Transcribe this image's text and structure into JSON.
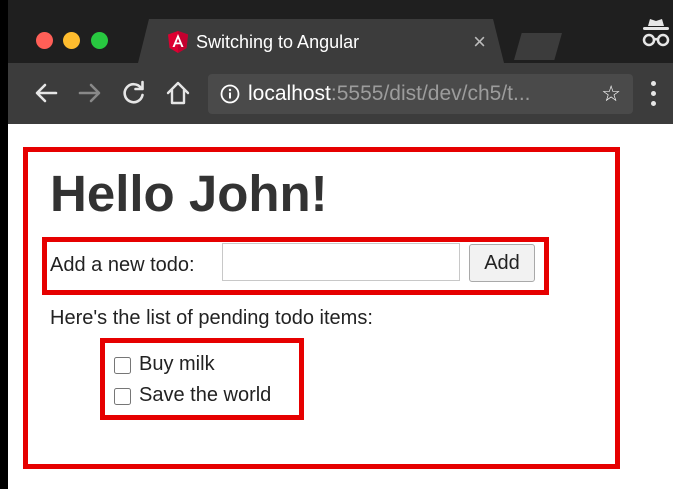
{
  "browser": {
    "tab": {
      "title": "Switching to Angular",
      "close_glyph": "×",
      "icon": "angular-logo"
    },
    "address_bar": {
      "host": "localhost",
      "path": ":5555/dist/dev/ch5/t...",
      "info_icon": "info-icon",
      "star_glyph": "☆"
    },
    "nav": {
      "back": "←",
      "forward": "→",
      "reload": "C",
      "home": "⌂"
    },
    "colors": {
      "close": "#ff5f57",
      "minimize": "#febc2e",
      "maximize": "#28c840",
      "highlight": "#e60000"
    }
  },
  "page": {
    "heading": "Hello John!",
    "form": {
      "label": "Add a new todo:",
      "input_value": "",
      "add_label": "Add"
    },
    "list_caption": "Here's the list of pending todo items:",
    "todos": [
      {
        "label": "Buy milk",
        "checked": false
      },
      {
        "label": "Save the world",
        "checked": false
      }
    ]
  }
}
